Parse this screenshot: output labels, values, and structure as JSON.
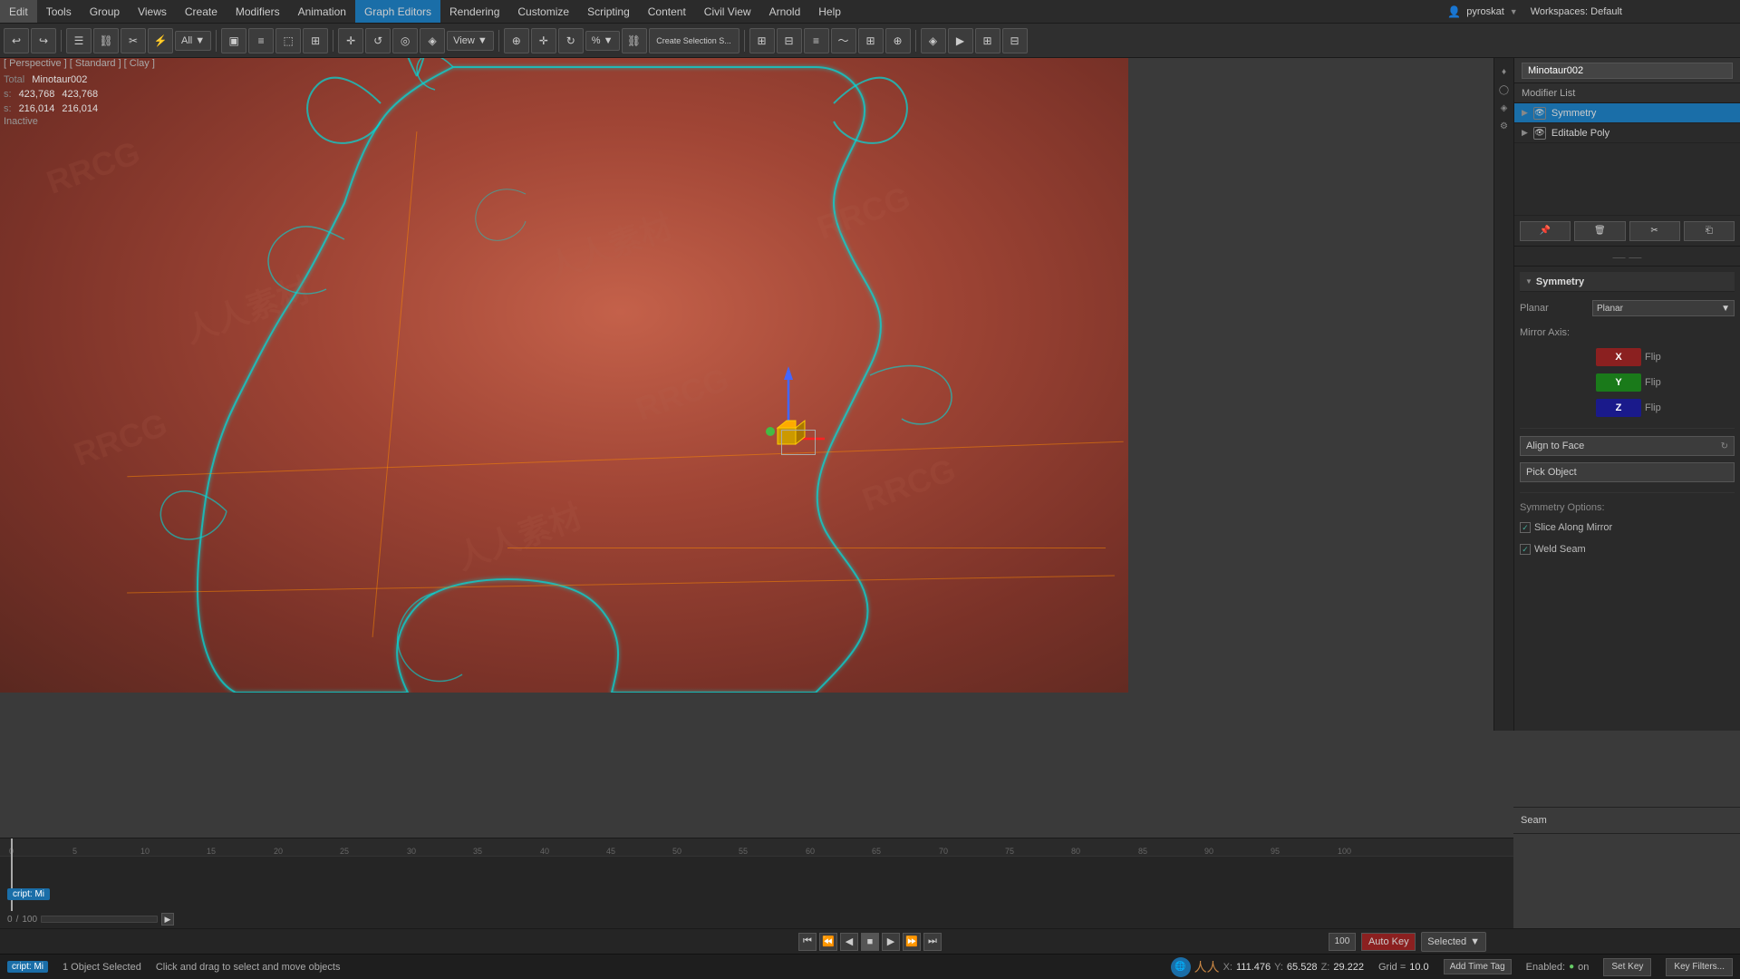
{
  "menu": {
    "items": [
      "Edit",
      "Tools",
      "Group",
      "Views",
      "Create",
      "Modifiers",
      "Animation",
      "Graph Editors",
      "Rendering",
      "Customize",
      "Scripting",
      "Content",
      "Civil View",
      "Arnold",
      "Help"
    ]
  },
  "user": {
    "name": "pyroskat",
    "workspace_label": "Workspaces: Default"
  },
  "breadcrumb": "[ Perspective ] [ Standard ] [ Clay ]",
  "stats": {
    "total_label": "Total",
    "total_name": "Minotaur002",
    "verts_label": "s:",
    "verts_value": "423,768",
    "verts_value2": "423,768",
    "polys_label": "s:",
    "polys_value": "216,014",
    "polys_value2": "216,014"
  },
  "inactive_label": "Inactive",
  "right_panel": {
    "object_name": "Minotaur002",
    "modifier_list_label": "Modifier List",
    "modifiers": [
      {
        "name": "Symmetry",
        "selected": true
      },
      {
        "name": "Editable Poly",
        "selected": false
      }
    ],
    "symmetry": {
      "title": "Symmetry",
      "planar_label": "Planar",
      "planar_dropdown": "Planar",
      "mirror_axis_label": "Mirror Axis:",
      "x_btn": "X",
      "y_btn": "Y",
      "z_btn": "Z",
      "flip_label": "Flip",
      "align_to_face_btn": "Align to Face",
      "pick_object_btn": "Pick Object",
      "symmetry_options_label": "Symmetry Options:",
      "slice_along_mirror": "Slice Along Mirror",
      "weld_seam": "Weld Seam"
    }
  },
  "seam": {
    "text": "Seam"
  },
  "timeline": {
    "progress_current": "0",
    "progress_total": "100",
    "range_marks": [
      "0",
      "5",
      "10",
      "15",
      "20",
      "25",
      "30",
      "35",
      "40",
      "45",
      "50",
      "55",
      "60",
      "65",
      "70",
      "75",
      "80",
      "85",
      "90",
      "95",
      "100"
    ]
  },
  "transport": {
    "auto_key_label": "Auto Key",
    "selected_label": "Selected",
    "set_key_label": "Set Key",
    "key_filters_label": "Key Filters..."
  },
  "status_bar": {
    "selected_count": "1 Object Selected",
    "hint": "Click and drag to select and move objects",
    "x_label": "X:",
    "x_value": "111.476",
    "y_label": "Y:",
    "y_value": "65.528",
    "z_label": "Z:",
    "z_value": "29.222",
    "grid_label": "Grid =",
    "grid_value": "10.0",
    "add_time_tag_btn": "Add Time Tag",
    "enabled_label": "Enabled:",
    "enabled_value": "on"
  },
  "script_label": "cript: Mi",
  "icons": {
    "undo": "↩",
    "redo": "↪",
    "link": "⛓",
    "pin": "📌",
    "search": "🔍",
    "eye": "👁",
    "delete": "🗑",
    "wrench": "🔧",
    "arrow_down": "▼",
    "arrow_right": "▶",
    "arrow_left": "◀",
    "check": "✓",
    "plus": "+",
    "minus": "−",
    "gear": "⚙",
    "play": "▶",
    "pause": "⏸",
    "stop": "⏹",
    "skip_forward": "⏭",
    "skip_back": "⏮",
    "step_forward": "⏩",
    "step_back": "⏪",
    "circle": "●",
    "square": "■",
    "triangle": "▲"
  }
}
